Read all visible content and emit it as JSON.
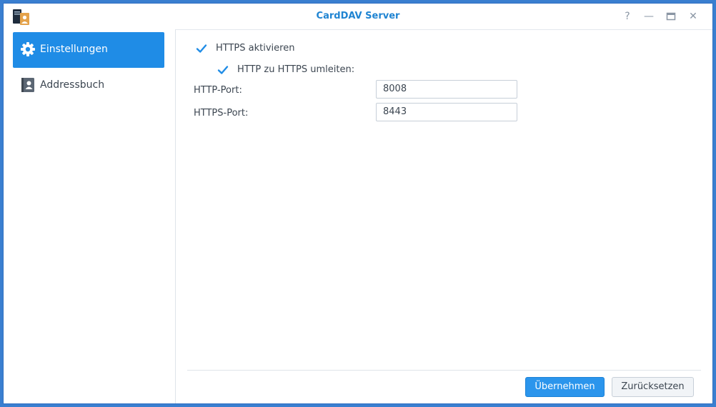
{
  "window": {
    "title": "CardDAV Server",
    "app_icon": "carddav-app-icon",
    "controls": [
      "help-icon",
      "minimize-icon",
      "maximize-icon",
      "close-icon"
    ],
    "help_glyph": "?",
    "minimize_glyph": "—",
    "close_glyph": "✕"
  },
  "sidebar": {
    "items": [
      {
        "label": "Einstellungen",
        "icon": "gear-icon",
        "active": true
      },
      {
        "label": "Addressbuch",
        "icon": "address-book-icon",
        "active": false
      }
    ]
  },
  "settings": {
    "https_enable": {
      "label": "HTTPS aktivieren",
      "checked": true
    },
    "http_redirect": {
      "label": "HTTP zu HTTPS umleiten:",
      "checked": true
    },
    "http_port": {
      "label": "HTTP-Port:",
      "value": "8008"
    },
    "https_port": {
      "label": "HTTPS-Port:",
      "value": "8443"
    }
  },
  "footer": {
    "apply_label": "Übernehmen",
    "reset_label": "Zurücksetzen"
  },
  "colors": {
    "accent": "#1f8ce6",
    "title": "#1f84d2",
    "desktop": "#3a7fd0"
  }
}
